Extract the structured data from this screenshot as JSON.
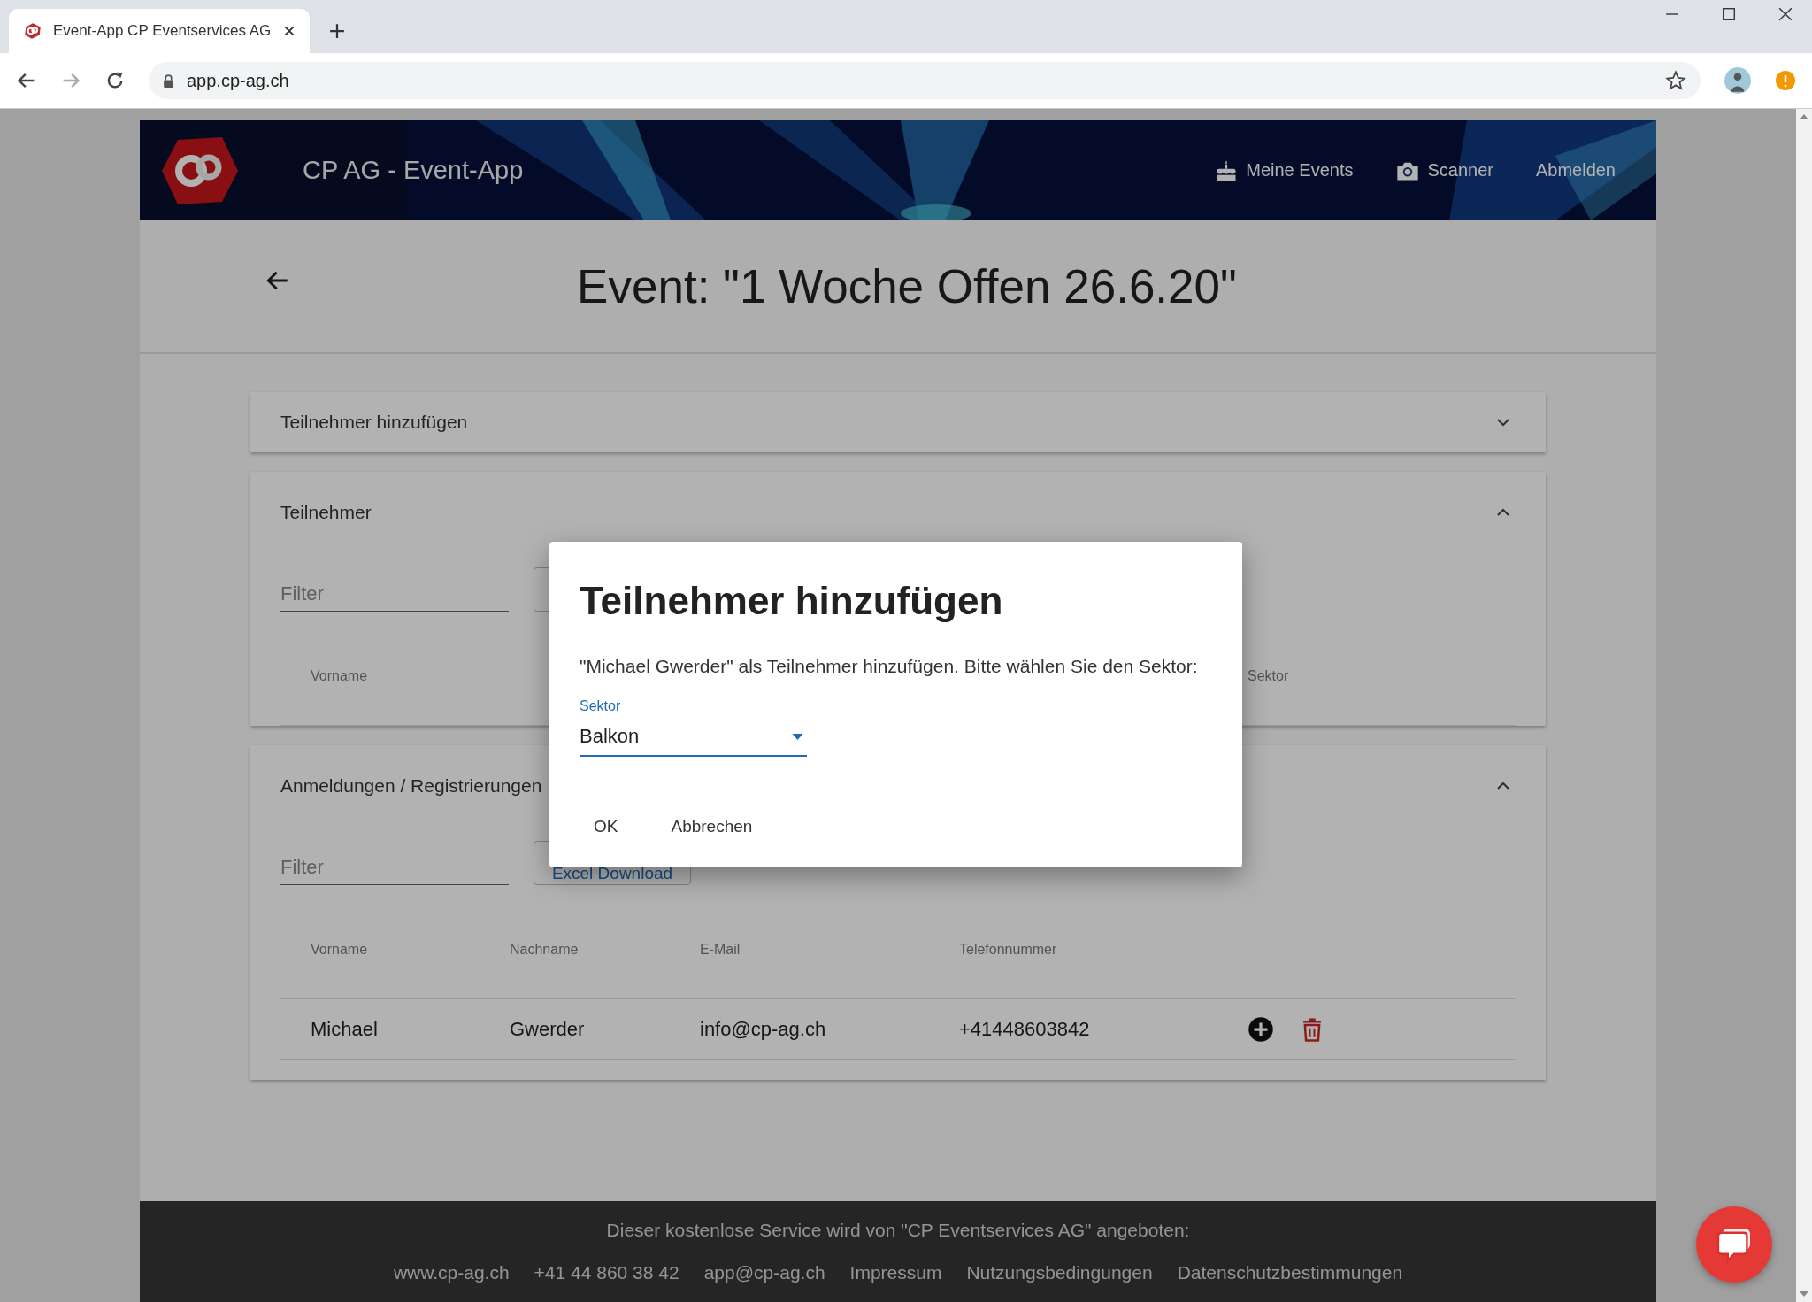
{
  "browser": {
    "tab_title": "Event-App CP Eventservices AG",
    "url": "app.cp-ag.ch"
  },
  "header": {
    "title": "CP AG - Event-App",
    "nav": [
      {
        "label": "Meine Events",
        "kind": "cake"
      },
      {
        "label": "Scanner",
        "kind": "camera"
      },
      {
        "label": "Abmelden",
        "kind": "text"
      }
    ]
  },
  "event_title": "Event: \"1 Woche Offen 26.6.20\"",
  "panels": [
    {
      "title": "Teilnehmer hinzufügen",
      "expanded": false
    },
    {
      "title": "Teilnehmer",
      "expanded": true,
      "filter": {
        "placeholder": "Filter"
      },
      "has_button": true,
      "columns": [
        "Vorname",
        "Sektor"
      ]
    },
    {
      "title": "Anmeldungen / Registrierungen",
      "expanded": true,
      "filter": {
        "placeholder": "Filter"
      },
      "has_button": true,
      "button": "Excel Download",
      "columns": [
        "Vorname",
        "Nachname",
        "E-Mail",
        "Telefonnummer"
      ],
      "rows": [
        {
          "cells": [
            "Michael",
            "Gwerder",
            "info@cp-ag.ch",
            "+41448603842"
          ]
        }
      ]
    }
  ],
  "dialog": {
    "title": "Teilnehmer hinzufügen",
    "message": "\"Michael Gwerder\" als Teilnehmer hinzufügen. Bitte wählen Sie den Sektor:",
    "select": {
      "label": "Sektor",
      "value": "Balkon"
    },
    "buttons": [
      "OK",
      "Abbrechen"
    ]
  },
  "footer": {
    "text": "Dieser kostenlose Service wird von \"CP Eventservices AG\" angeboten:",
    "links": [
      "www.cp-ag.ch",
      "+41 44 860 38 42",
      "app@cp-ag.ch",
      "Impressum",
      "Nutzungsbedingungen",
      "Datenschutzbestimmungen"
    ]
  }
}
